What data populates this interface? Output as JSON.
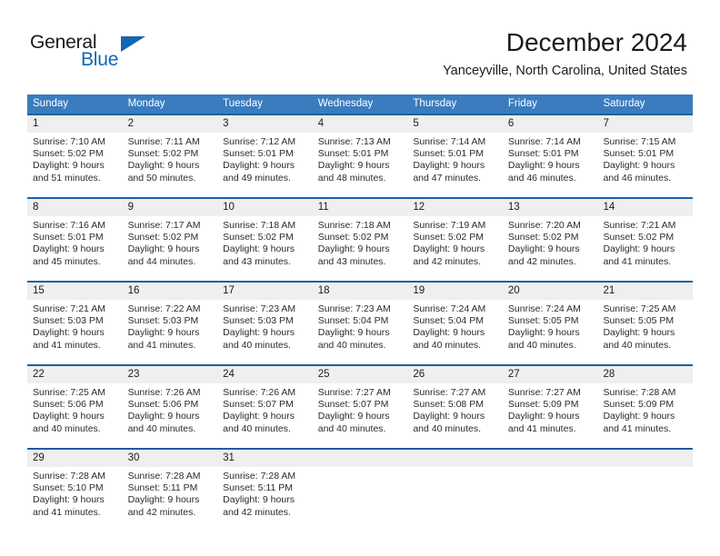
{
  "brand": {
    "name_part1": "General",
    "name_part2": "Blue",
    "accent_color": "#1267b2"
  },
  "header": {
    "month_title": "December 2024",
    "location": "Yanceyville, North Carolina, United States"
  },
  "theme": {
    "header_row_bg": "#3a7cbe",
    "week_divider": "#1d5fa0",
    "daynum_bg": "#efefef",
    "text": "#2b2b2b"
  },
  "weekdays": [
    "Sunday",
    "Monday",
    "Tuesday",
    "Wednesday",
    "Thursday",
    "Friday",
    "Saturday"
  ],
  "weeks": [
    {
      "days": [
        {
          "num": "1",
          "l1": "Sunrise: 7:10 AM",
          "l2": "Sunset: 5:02 PM",
          "l3": "Daylight: 9 hours",
          "l4": "and 51 minutes."
        },
        {
          "num": "2",
          "l1": "Sunrise: 7:11 AM",
          "l2": "Sunset: 5:02 PM",
          "l3": "Daylight: 9 hours",
          "l4": "and 50 minutes."
        },
        {
          "num": "3",
          "l1": "Sunrise: 7:12 AM",
          "l2": "Sunset: 5:01 PM",
          "l3": "Daylight: 9 hours",
          "l4": "and 49 minutes."
        },
        {
          "num": "4",
          "l1": "Sunrise: 7:13 AM",
          "l2": "Sunset: 5:01 PM",
          "l3": "Daylight: 9 hours",
          "l4": "and 48 minutes."
        },
        {
          "num": "5",
          "l1": "Sunrise: 7:14 AM",
          "l2": "Sunset: 5:01 PM",
          "l3": "Daylight: 9 hours",
          "l4": "and 47 minutes."
        },
        {
          "num": "6",
          "l1": "Sunrise: 7:14 AM",
          "l2": "Sunset: 5:01 PM",
          "l3": "Daylight: 9 hours",
          "l4": "and 46 minutes."
        },
        {
          "num": "7",
          "l1": "Sunrise: 7:15 AM",
          "l2": "Sunset: 5:01 PM",
          "l3": "Daylight: 9 hours",
          "l4": "and 46 minutes."
        }
      ]
    },
    {
      "days": [
        {
          "num": "8",
          "l1": "Sunrise: 7:16 AM",
          "l2": "Sunset: 5:01 PM",
          "l3": "Daylight: 9 hours",
          "l4": "and 45 minutes."
        },
        {
          "num": "9",
          "l1": "Sunrise: 7:17 AM",
          "l2": "Sunset: 5:02 PM",
          "l3": "Daylight: 9 hours",
          "l4": "and 44 minutes."
        },
        {
          "num": "10",
          "l1": "Sunrise: 7:18 AM",
          "l2": "Sunset: 5:02 PM",
          "l3": "Daylight: 9 hours",
          "l4": "and 43 minutes."
        },
        {
          "num": "11",
          "l1": "Sunrise: 7:18 AM",
          "l2": "Sunset: 5:02 PM",
          "l3": "Daylight: 9 hours",
          "l4": "and 43 minutes."
        },
        {
          "num": "12",
          "l1": "Sunrise: 7:19 AM",
          "l2": "Sunset: 5:02 PM",
          "l3": "Daylight: 9 hours",
          "l4": "and 42 minutes."
        },
        {
          "num": "13",
          "l1": "Sunrise: 7:20 AM",
          "l2": "Sunset: 5:02 PM",
          "l3": "Daylight: 9 hours",
          "l4": "and 42 minutes."
        },
        {
          "num": "14",
          "l1": "Sunrise: 7:21 AM",
          "l2": "Sunset: 5:02 PM",
          "l3": "Daylight: 9 hours",
          "l4": "and 41 minutes."
        }
      ]
    },
    {
      "days": [
        {
          "num": "15",
          "l1": "Sunrise: 7:21 AM",
          "l2": "Sunset: 5:03 PM",
          "l3": "Daylight: 9 hours",
          "l4": "and 41 minutes."
        },
        {
          "num": "16",
          "l1": "Sunrise: 7:22 AM",
          "l2": "Sunset: 5:03 PM",
          "l3": "Daylight: 9 hours",
          "l4": "and 41 minutes."
        },
        {
          "num": "17",
          "l1": "Sunrise: 7:23 AM",
          "l2": "Sunset: 5:03 PM",
          "l3": "Daylight: 9 hours",
          "l4": "and 40 minutes."
        },
        {
          "num": "18",
          "l1": "Sunrise: 7:23 AM",
          "l2": "Sunset: 5:04 PM",
          "l3": "Daylight: 9 hours",
          "l4": "and 40 minutes."
        },
        {
          "num": "19",
          "l1": "Sunrise: 7:24 AM",
          "l2": "Sunset: 5:04 PM",
          "l3": "Daylight: 9 hours",
          "l4": "and 40 minutes."
        },
        {
          "num": "20",
          "l1": "Sunrise: 7:24 AM",
          "l2": "Sunset: 5:05 PM",
          "l3": "Daylight: 9 hours",
          "l4": "and 40 minutes."
        },
        {
          "num": "21",
          "l1": "Sunrise: 7:25 AM",
          "l2": "Sunset: 5:05 PM",
          "l3": "Daylight: 9 hours",
          "l4": "and 40 minutes."
        }
      ]
    },
    {
      "days": [
        {
          "num": "22",
          "l1": "Sunrise: 7:25 AM",
          "l2": "Sunset: 5:06 PM",
          "l3": "Daylight: 9 hours",
          "l4": "and 40 minutes."
        },
        {
          "num": "23",
          "l1": "Sunrise: 7:26 AM",
          "l2": "Sunset: 5:06 PM",
          "l3": "Daylight: 9 hours",
          "l4": "and 40 minutes."
        },
        {
          "num": "24",
          "l1": "Sunrise: 7:26 AM",
          "l2": "Sunset: 5:07 PM",
          "l3": "Daylight: 9 hours",
          "l4": "and 40 minutes."
        },
        {
          "num": "25",
          "l1": "Sunrise: 7:27 AM",
          "l2": "Sunset: 5:07 PM",
          "l3": "Daylight: 9 hours",
          "l4": "and 40 minutes."
        },
        {
          "num": "26",
          "l1": "Sunrise: 7:27 AM",
          "l2": "Sunset: 5:08 PM",
          "l3": "Daylight: 9 hours",
          "l4": "and 40 minutes."
        },
        {
          "num": "27",
          "l1": "Sunrise: 7:27 AM",
          "l2": "Sunset: 5:09 PM",
          "l3": "Daylight: 9 hours",
          "l4": "and 41 minutes."
        },
        {
          "num": "28",
          "l1": "Sunrise: 7:28 AM",
          "l2": "Sunset: 5:09 PM",
          "l3": "Daylight: 9 hours",
          "l4": "and 41 minutes."
        }
      ]
    },
    {
      "days": [
        {
          "num": "29",
          "l1": "Sunrise: 7:28 AM",
          "l2": "Sunset: 5:10 PM",
          "l3": "Daylight: 9 hours",
          "l4": "and 41 minutes."
        },
        {
          "num": "30",
          "l1": "Sunrise: 7:28 AM",
          "l2": "Sunset: 5:11 PM",
          "l3": "Daylight: 9 hours",
          "l4": "and 42 minutes."
        },
        {
          "num": "31",
          "l1": "Sunrise: 7:28 AM",
          "l2": "Sunset: 5:11 PM",
          "l3": "Daylight: 9 hours",
          "l4": "and 42 minutes."
        },
        {
          "num": "",
          "l1": "",
          "l2": "",
          "l3": "",
          "l4": ""
        },
        {
          "num": "",
          "l1": "",
          "l2": "",
          "l3": "",
          "l4": ""
        },
        {
          "num": "",
          "l1": "",
          "l2": "",
          "l3": "",
          "l4": ""
        },
        {
          "num": "",
          "l1": "",
          "l2": "",
          "l3": "",
          "l4": ""
        }
      ]
    }
  ]
}
